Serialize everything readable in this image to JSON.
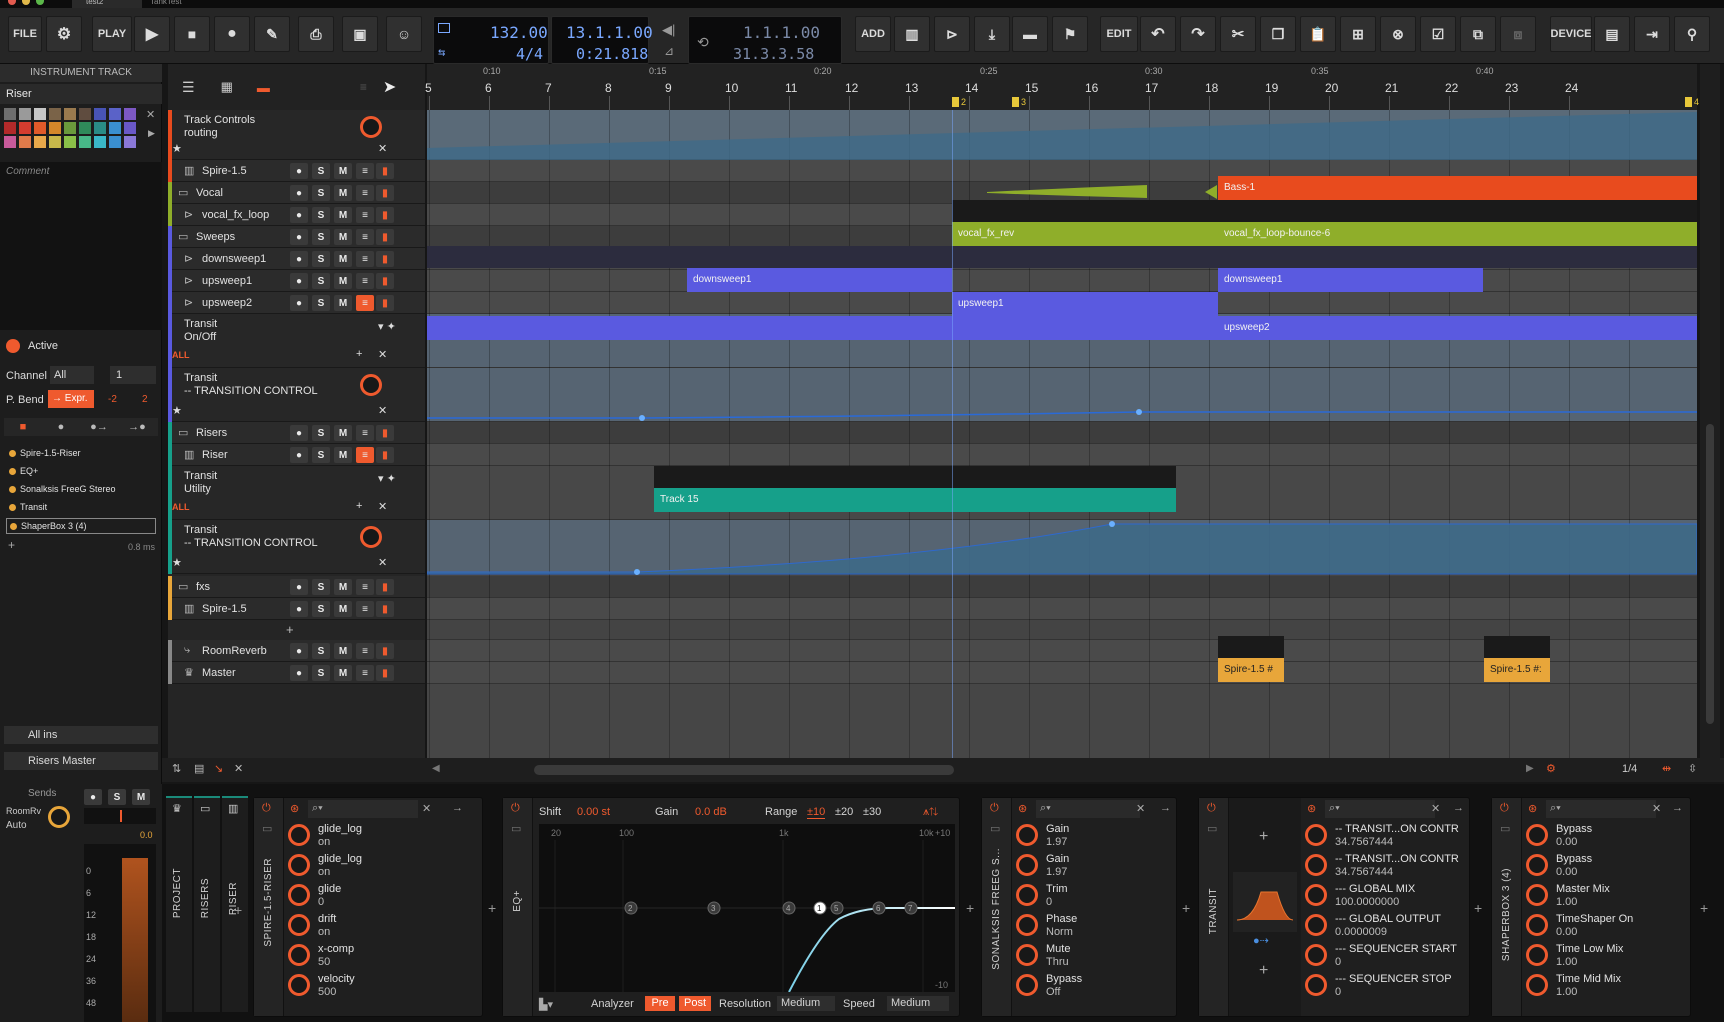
{
  "window": {
    "tab_name": "test2",
    "tab2_name": "TankTest"
  },
  "toolbar": {
    "file": "FILE",
    "play": "PLAY",
    "add": "ADD",
    "edit": "EDIT",
    "device": "DEVICE",
    "tempo": "132.00",
    "meter": "4/4",
    "position": "13.1.1.00",
    "time": "0:21.818",
    "loop_start": "1.1.1.00",
    "loop_end": "31.3.3.58"
  },
  "inspector": {
    "title": "INSTRUMENT TRACK",
    "track_name": "Riser",
    "comment_placeholder": "Comment",
    "active": "Active",
    "channel_label": "Channel",
    "channel_value": "All",
    "channel_number": "1",
    "pbend_label": "P. Bend",
    "expr": "→ Expr.",
    "bend_down": "-2",
    "bend_up": "2",
    "fx": [
      "Spire-1.5-Riser",
      "EQ+",
      "Sonalksis FreeG Stereo",
      "Transit",
      "ShaperBox 3 (4)"
    ],
    "latency": "0.8 ms",
    "input": "All ins",
    "output": "Risers Master",
    "sends": "Sends",
    "roomrv": "RoomRv",
    "auto": "Auto",
    "meter_value": "0.0",
    "meter_scale": [
      "0",
      "6",
      "12",
      "18",
      "24",
      "36",
      "48"
    ],
    "palette": [
      "#6e6e6e",
      "#9a9a9a",
      "#c6c6c6",
      "#7a6348",
      "#9a7a4e",
      "#5f4c3f",
      "#4854b6",
      "#5a62c8",
      "#7d58c4",
      "#b22a2a",
      "#d43c2f",
      "#e05a2a",
      "#d4882a",
      "#6a9a3c",
      "#2f8a5a",
      "#2a8c86",
      "#3a8fd0",
      "#6a58c8",
      "#c85a9a",
      "#e07a4a",
      "#e8a84a",
      "#c8b84a",
      "#8ac048",
      "#48b888",
      "#3ab8c8",
      "#3a8fd0",
      "#8a78d8"
    ]
  },
  "ruler": {
    "bars": [
      "5",
      "6",
      "7",
      "8",
      "9",
      "10",
      "11",
      "12",
      "13",
      "14",
      "15",
      "16",
      "17",
      "18",
      "19",
      "20",
      "21",
      "22",
      "23",
      "24"
    ],
    "times": [
      "0:10",
      "0:15",
      "0:20",
      "0:25",
      "0:30",
      "0:35",
      "0:40"
    ],
    "markers": [
      "2",
      "3",
      "4"
    ]
  },
  "tracks": [
    {
      "name": "Track Controls",
      "sub": "routing",
      "type": "control"
    },
    {
      "name": "Spire-1.5",
      "type": "inst"
    },
    {
      "name": "Vocal",
      "type": "group"
    },
    {
      "name": "vocal_fx_loop",
      "type": "audio"
    },
    {
      "name": "Sweeps",
      "type": "group"
    },
    {
      "name": "downsweep1",
      "type": "audio"
    },
    {
      "name": "upsweep1",
      "type": "audio"
    },
    {
      "name": "upsweep2",
      "type": "audio"
    },
    {
      "name": "Transit",
      "sub": "On/Off",
      "type": "lane"
    },
    {
      "name": "Transit",
      "sub": "-- TRANSITION CONTROL",
      "type": "lane2"
    },
    {
      "name": "Risers",
      "type": "group"
    },
    {
      "name": "Riser",
      "type": "inst"
    },
    {
      "name": "Transit",
      "sub": "Utility",
      "type": "lane"
    },
    {
      "name": "Transit",
      "sub": "-- TRANSITION CONTROL",
      "type": "lane2"
    },
    {
      "name": "fxs",
      "type": "group"
    },
    {
      "name": "Spire-1.5",
      "type": "inst"
    },
    {
      "name": "RoomReverb",
      "type": "fx"
    },
    {
      "name": "Master",
      "type": "master"
    }
  ],
  "all_label": "ALL",
  "clips": {
    "bass": "Bass-1",
    "vocal_rev": "vocal_fx_rev",
    "vocal_loop": "vocal_fx_loop-bounce-6",
    "downsweep_a": "downsweep1",
    "downsweep_b": "downsweep1",
    "upsweep1": "upsweep1",
    "upsweep2": "upsweep2",
    "track15": "Track 15",
    "spire_a": "Spire-1.5 #",
    "spire_b": "Spire-1.5 #:"
  },
  "bottom_bar": {
    "zoom": "1/4"
  },
  "devices": {
    "project": "PROJECT",
    "risers": "RISERS",
    "riser": "RISER",
    "spire": {
      "title": "SPIRE-1.5-RISER",
      "params": [
        {
          "name": "glide_log",
          "value": "on"
        },
        {
          "name": "glide_log",
          "value": "on"
        },
        {
          "name": "glide",
          "value": "0"
        },
        {
          "name": "drift",
          "value": "on"
        },
        {
          "name": "x-comp",
          "value": "50"
        },
        {
          "name": "velocity",
          "value": "500"
        }
      ]
    },
    "eq": {
      "title": "EQ+",
      "shift_label": "Shift",
      "shift_value": "0.00 st",
      "gain_label": "Gain",
      "gain_value": "0.0 dB",
      "range_label": "Range",
      "range_opts": [
        "±10",
        "±20",
        "±30"
      ],
      "freq_labels": [
        "20",
        "100",
        "1k",
        "10k"
      ],
      "db_top": "+10",
      "db_bottom": "-10",
      "analyzer": "Analyzer",
      "pre": "Pre",
      "post": "Post",
      "resolution": "Resolution",
      "resolution_value": "Medium",
      "speed": "Speed",
      "speed_value": "Medium",
      "bands": [
        "2",
        "3",
        "4",
        "1",
        "5",
        "6",
        "7"
      ]
    },
    "sonalksis": {
      "title": "SONALKSIS FREEG S...",
      "params": [
        {
          "name": "Gain",
          "value": "1.97"
        },
        {
          "name": "Gain",
          "value": "1.97"
        },
        {
          "name": "Trim",
          "value": "0"
        },
        {
          "name": "Phase",
          "value": "Norm"
        },
        {
          "name": "Mute",
          "value": "Thru"
        },
        {
          "name": "Bypass",
          "value": "Off"
        }
      ]
    },
    "transit": {
      "title": "TRANSIT",
      "params": [
        {
          "name": "-- TRANSIT...ON CONTR",
          "value": "34.7567444"
        },
        {
          "name": "-- TRANSIT...ON CONTR",
          "value": "34.7567444"
        },
        {
          "name": "--- GLOBAL MIX",
          "value": "100.0000000"
        },
        {
          "name": "--- GLOBAL OUTPUT",
          "value": "0.0000009"
        },
        {
          "name": "--- SEQUENCER START",
          "value": "0"
        },
        {
          "name": "--- SEQUENCER STOP",
          "value": "0"
        }
      ]
    },
    "shaperbox": {
      "title": "SHAPERBOX 3 (4)",
      "params": [
        {
          "name": "Bypass",
          "value": "0.00"
        },
        {
          "name": "Bypass",
          "value": "0.00"
        },
        {
          "name": "Master Mix",
          "value": "1.00"
        },
        {
          "name": "TimeShaper On",
          "value": "0.00"
        },
        {
          "name": "Time Low Mix",
          "value": "1.00"
        },
        {
          "name": "Time Mid Mix",
          "value": "1.00"
        }
      ]
    }
  }
}
